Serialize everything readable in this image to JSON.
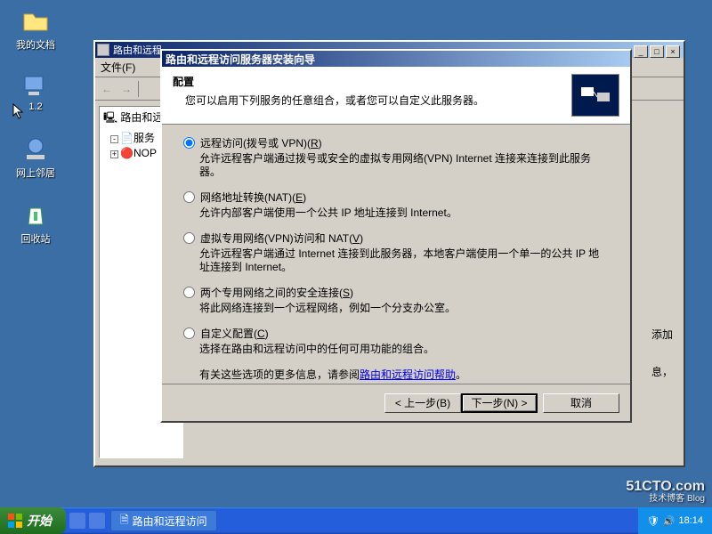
{
  "desktop": {
    "icons": [
      {
        "label": "我的文档"
      },
      {
        "label": "1.2"
      },
      {
        "label": "网上邻居"
      },
      {
        "label": "回收站"
      }
    ]
  },
  "parent_window": {
    "title": "路由和远程",
    "menu_file": "文件(F)",
    "tree": {
      "root": "路由和远程",
      "child1": "服务",
      "child2": "NOP"
    },
    "side_hint1": "添加",
    "side_hint2": "息，"
  },
  "wizard": {
    "title": "路由和远程访问服务器安装向导",
    "header_title": "配置",
    "header_sub": "您可以启用下列服务的任意组合，或者您可以自定义此服务器。",
    "options": [
      {
        "label": "远程访问(拨号或 VPN)(R)",
        "desc": "允许远程客户端通过拨号或安全的虚拟专用网络(VPN) Internet 连接来连接到此服务器。",
        "checked": true
      },
      {
        "label": "网络地址转换(NAT)(E)",
        "desc": "允许内部客户端使用一个公共 IP 地址连接到 Internet。",
        "checked": false
      },
      {
        "label": "虚拟专用网络(VPN)访问和 NAT(V)",
        "desc": "允许远程客户端通过 Internet 连接到此服务器，本地客户端使用一个单一的公共 IP 地址连接到 Internet。",
        "checked": false
      },
      {
        "label": "两个专用网络之间的安全连接(S)",
        "desc": "将此网络连接到一个远程网络，例如一个分支办公室。",
        "checked": false
      },
      {
        "label": "自定义配置(C)",
        "desc": "选择在路由和远程访问中的任何可用功能的组合。",
        "checked": false
      }
    ],
    "more_info_prefix": "有关这些选项的更多信息，请参阅",
    "more_info_link": "路由和远程访问帮助",
    "btn_back": "< 上一步(B)",
    "btn_next": "下一步(N) >",
    "btn_cancel": "取消"
  },
  "taskbar": {
    "start": "开始",
    "task": "路由和远程访问",
    "time": "18:14"
  },
  "watermark": {
    "main": "51CTO.com",
    "sub": "技术博客      Blog"
  }
}
